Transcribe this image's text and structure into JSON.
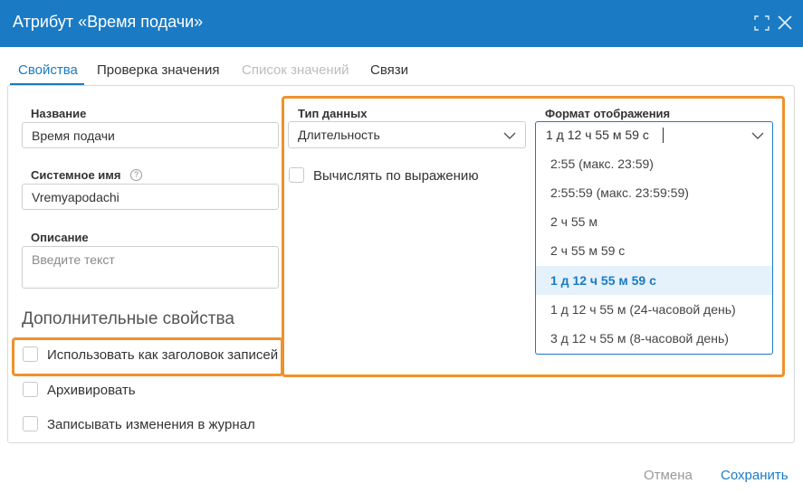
{
  "window": {
    "title": "Атрибут «Время подачи»"
  },
  "tabs": [
    {
      "label": "Свойства",
      "state": "active"
    },
    {
      "label": "Проверка значения",
      "state": "normal"
    },
    {
      "label": "Список значений",
      "state": "disabled"
    },
    {
      "label": "Связи",
      "state": "normal"
    }
  ],
  "form": {
    "name": {
      "label": "Название",
      "value": "Время подачи"
    },
    "system_name": {
      "label": "Системное имя",
      "value": "Vremyapodachi",
      "help_glyph": "?"
    },
    "description": {
      "label": "Описание",
      "placeholder": "Введите текст"
    },
    "additional_title": "Дополнительные свойства",
    "checkboxes": [
      {
        "label": "Использовать как заголовок записей",
        "checked": false
      },
      {
        "label": "Архивировать",
        "checked": false
      },
      {
        "label": "Записывать изменения в журнал",
        "checked": false
      }
    ],
    "data_type": {
      "label": "Тип данных",
      "value": "Длительность"
    },
    "compute_by_expression": {
      "label": "Вычислять по выражению",
      "checked": false
    },
    "display_format": {
      "label": "Формат отображения",
      "value": "1 д 12 ч 55 м 59 с",
      "options": [
        "2:55 (макс. 23:59)",
        "2:55:59 (макс. 23:59:59)",
        "2 ч 55 м",
        "2 ч 55 м 59 с",
        "1 д 12 ч 55 м 59 с",
        "1 д 12 ч 55 м (24-часовой день)",
        "3 д 12 ч 55 м (8-часовой день)"
      ],
      "selected_index": 4
    }
  },
  "footer": {
    "cancel_label": "Отмена",
    "save_label": "Сохранить"
  },
  "colors": {
    "accent": "#1a7bc4",
    "highlight": "#f0922b",
    "selected_bg": "#e5f1fb"
  }
}
